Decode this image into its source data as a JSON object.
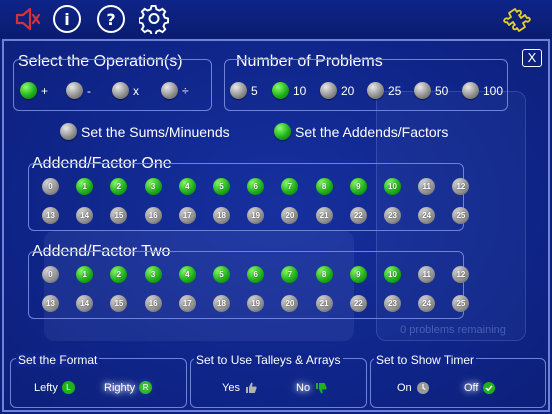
{
  "colors": {
    "background": "#0c1f7a",
    "accent_green": "#1fb21a",
    "border": "#6f83d6",
    "icon_yellow": "#e5d024",
    "icon_red": "#d1343b"
  },
  "topbar": {
    "icons": [
      "speaker-muted-icon",
      "info-icon",
      "help-icon",
      "settings-gear-icon",
      "puzzle-icon"
    ],
    "info_glyph": "i",
    "help_glyph": "?"
  },
  "close_label": "X",
  "operations": {
    "title": "Select the Operation(s)",
    "items": [
      {
        "label": "+",
        "selected": true
      },
      {
        "label": "-",
        "selected": false
      },
      {
        "label": "x",
        "selected": false
      },
      {
        "label": "÷",
        "selected": false
      }
    ]
  },
  "problems": {
    "title": "Number of  Problems",
    "items": [
      {
        "label": "5",
        "selected": false
      },
      {
        "label": "10",
        "selected": true
      },
      {
        "label": "20",
        "selected": false
      },
      {
        "label": "25",
        "selected": false
      },
      {
        "label": "50",
        "selected": false
      },
      {
        "label": "100",
        "selected": false
      }
    ]
  },
  "mode": {
    "sums_label": "Set the Sums/Minuends",
    "sums_selected": false,
    "addends_label": "Set the Addends/Factors",
    "addends_selected": true
  },
  "factor_one": {
    "title": "Addend/Factor One",
    "numbers": [
      "0",
      "1",
      "2",
      "3",
      "4",
      "5",
      "6",
      "7",
      "8",
      "9",
      "10",
      "11",
      "12",
      "13",
      "14",
      "15",
      "16",
      "17",
      "18",
      "19",
      "20",
      "21",
      "22",
      "23",
      "24",
      "25"
    ],
    "selected": [
      "1",
      "2",
      "3",
      "4",
      "5",
      "6",
      "7",
      "8",
      "9",
      "10"
    ]
  },
  "factor_two": {
    "title": "Addend/Factor Two",
    "numbers": [
      "0",
      "1",
      "2",
      "3",
      "4",
      "5",
      "6",
      "7",
      "8",
      "9",
      "10",
      "11",
      "12",
      "13",
      "14",
      "15",
      "16",
      "17",
      "18",
      "19",
      "20",
      "21",
      "22",
      "23",
      "24",
      "25"
    ],
    "selected": [
      "1",
      "2",
      "3",
      "4",
      "5",
      "6",
      "7",
      "8",
      "9",
      "10"
    ]
  },
  "background_text": "0 problems remaining",
  "format": {
    "title": "Set the Format",
    "lefty_label": "Lefty",
    "lefty_badge": "L",
    "righty_label": "Righty",
    "righty_badge": "R",
    "selected": "Righty"
  },
  "talleys": {
    "title": "Set to Use Talleys & Arrays",
    "yes_label": "Yes",
    "no_label": "No",
    "selected": "No"
  },
  "timer": {
    "title": "Set to Show Timer",
    "on_label": "On",
    "off_label": "Off",
    "selected": "Off"
  }
}
